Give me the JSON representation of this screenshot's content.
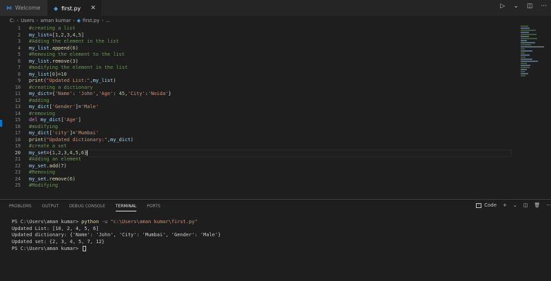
{
  "tabs": [
    {
      "label": "Welcome",
      "icon": "vscode-logo-icon"
    },
    {
      "label": "first.py",
      "icon": "python-file-icon"
    }
  ],
  "breadcrumb": [
    "C:",
    "Users",
    "aman kumar",
    "first.py",
    "..."
  ],
  "code_lines": [
    {
      "n": "1",
      "segs": [
        {
          "t": "#creating a list",
          "c": "comment"
        }
      ]
    },
    {
      "n": "2",
      "segs": [
        {
          "t": "my_list",
          "c": "var"
        },
        {
          "t": "=[",
          "c": "plain"
        },
        {
          "t": "1",
          "c": "num"
        },
        {
          "t": ",",
          "c": "plain"
        },
        {
          "t": "2",
          "c": "num"
        },
        {
          "t": ",",
          "c": "plain"
        },
        {
          "t": "3",
          "c": "num"
        },
        {
          "t": ",",
          "c": "plain"
        },
        {
          "t": "4",
          "c": "num"
        },
        {
          "t": ",",
          "c": "plain"
        },
        {
          "t": "5",
          "c": "num"
        },
        {
          "t": "]",
          "c": "plain"
        }
      ]
    },
    {
      "n": "3",
      "segs": [
        {
          "t": "#Adding the element in the list",
          "c": "comment"
        }
      ]
    },
    {
      "n": "4",
      "segs": [
        {
          "t": "my_list",
          "c": "var"
        },
        {
          "t": ".",
          "c": "plain"
        },
        {
          "t": "append",
          "c": "fn"
        },
        {
          "t": "(",
          "c": "plain"
        },
        {
          "t": "6",
          "c": "num"
        },
        {
          "t": ")",
          "c": "plain"
        }
      ]
    },
    {
      "n": "5",
      "segs": [
        {
          "t": "#Removing the element to the list",
          "c": "comment"
        }
      ]
    },
    {
      "n": "6",
      "segs": [
        {
          "t": "my_list",
          "c": "var"
        },
        {
          "t": ".",
          "c": "plain"
        },
        {
          "t": "remove",
          "c": "fn"
        },
        {
          "t": "(",
          "c": "plain"
        },
        {
          "t": "3",
          "c": "num"
        },
        {
          "t": ")",
          "c": "plain"
        }
      ]
    },
    {
      "n": "7",
      "segs": [
        {
          "t": "#modifying the element in the list",
          "c": "comment"
        }
      ]
    },
    {
      "n": "8",
      "segs": [
        {
          "t": "my_list",
          "c": "var"
        },
        {
          "t": "[",
          "c": "plain"
        },
        {
          "t": "0",
          "c": "num"
        },
        {
          "t": "]=",
          "c": "plain"
        },
        {
          "t": "10",
          "c": "num"
        }
      ]
    },
    {
      "n": "9",
      "segs": [
        {
          "t": "print",
          "c": "fn"
        },
        {
          "t": "(",
          "c": "plain"
        },
        {
          "t": "\"Updated List:\"",
          "c": "str"
        },
        {
          "t": ",",
          "c": "plain"
        },
        {
          "t": "my_list",
          "c": "var"
        },
        {
          "t": ")",
          "c": "plain"
        }
      ]
    },
    {
      "n": "10",
      "segs": [
        {
          "t": "#creating a dictionary",
          "c": "comment"
        }
      ]
    },
    {
      "n": "11",
      "segs": [
        {
          "t": "my_dict",
          "c": "var"
        },
        {
          "t": "={",
          "c": "plain"
        },
        {
          "t": "'Name'",
          "c": "str"
        },
        {
          "t": ": ",
          "c": "plain"
        },
        {
          "t": "'John'",
          "c": "str"
        },
        {
          "t": ",",
          "c": "plain"
        },
        {
          "t": "'Age'",
          "c": "str"
        },
        {
          "t": ": ",
          "c": "plain"
        },
        {
          "t": "45",
          "c": "num"
        },
        {
          "t": ",",
          "c": "plain"
        },
        {
          "t": "'City'",
          "c": "str"
        },
        {
          "t": ":",
          "c": "plain"
        },
        {
          "t": "'Noida'",
          "c": "str"
        },
        {
          "t": "}",
          "c": "plain"
        }
      ]
    },
    {
      "n": "12",
      "segs": [
        {
          "t": "#adding",
          "c": "comment"
        }
      ]
    },
    {
      "n": "13",
      "segs": [
        {
          "t": "my_dict",
          "c": "var"
        },
        {
          "t": "[",
          "c": "plain"
        },
        {
          "t": "'Gender'",
          "c": "str"
        },
        {
          "t": "]=",
          "c": "plain"
        },
        {
          "t": "'Male'",
          "c": "str"
        }
      ]
    },
    {
      "n": "14",
      "segs": [
        {
          "t": "#removing",
          "c": "comment"
        }
      ]
    },
    {
      "n": "15",
      "segs": [
        {
          "t": "del ",
          "c": "kw"
        },
        {
          "t": "my_dict",
          "c": "var"
        },
        {
          "t": "[",
          "c": "plain"
        },
        {
          "t": "'Age'",
          "c": "str"
        },
        {
          "t": "]",
          "c": "plain"
        }
      ]
    },
    {
      "n": "16",
      "segs": [
        {
          "t": "#modifying",
          "c": "comment"
        }
      ]
    },
    {
      "n": "17",
      "segs": [
        {
          "t": "my_dict",
          "c": "var"
        },
        {
          "t": "[",
          "c": "plain"
        },
        {
          "t": "'city'",
          "c": "str"
        },
        {
          "t": "]=",
          "c": "plain"
        },
        {
          "t": "'Mumbai'",
          "c": "str"
        }
      ]
    },
    {
      "n": "18",
      "segs": [
        {
          "t": "print",
          "c": "fn"
        },
        {
          "t": "(",
          "c": "plain"
        },
        {
          "t": "\"Updated dictionary:\"",
          "c": "str"
        },
        {
          "t": ",",
          "c": "plain"
        },
        {
          "t": "my_dict",
          "c": "var"
        },
        {
          "t": ")",
          "c": "plain"
        }
      ]
    },
    {
      "n": "19",
      "segs": [
        {
          "t": "#create a set",
          "c": "comment"
        }
      ]
    },
    {
      "n": "20",
      "segs": [
        {
          "t": "my_set",
          "c": "var"
        },
        {
          "t": "={",
          "c": "plain"
        },
        {
          "t": "1",
          "c": "num"
        },
        {
          "t": ",",
          "c": "plain"
        },
        {
          "t": "2",
          "c": "num"
        },
        {
          "t": ",",
          "c": "plain"
        },
        {
          "t": "3",
          "c": "num"
        },
        {
          "t": ",",
          "c": "plain"
        },
        {
          "t": "4",
          "c": "num"
        },
        {
          "t": ",",
          "c": "plain"
        },
        {
          "t": "5",
          "c": "num"
        },
        {
          "t": ",",
          "c": "plain"
        },
        {
          "t": "6",
          "c": "num"
        },
        {
          "t": "}",
          "c": "plain"
        }
      ]
    },
    {
      "n": "21",
      "segs": [
        {
          "t": "#Adding an element",
          "c": "comment"
        }
      ]
    },
    {
      "n": "22",
      "segs": [
        {
          "t": "my_set",
          "c": "var"
        },
        {
          "t": ".",
          "c": "plain"
        },
        {
          "t": "add",
          "c": "fn"
        },
        {
          "t": "(",
          "c": "plain"
        },
        {
          "t": "7",
          "c": "num"
        },
        {
          "t": ")",
          "c": "plain"
        }
      ]
    },
    {
      "n": "23",
      "segs": [
        {
          "t": "#Removing",
          "c": "comment"
        }
      ]
    },
    {
      "n": "24",
      "segs": [
        {
          "t": "my_set",
          "c": "var"
        },
        {
          "t": ".",
          "c": "plain"
        },
        {
          "t": "remove",
          "c": "fn"
        },
        {
          "t": "(",
          "c": "plain"
        },
        {
          "t": "6",
          "c": "num"
        },
        {
          "t": ")",
          "c": "plain"
        }
      ]
    },
    {
      "n": "25",
      "segs": [
        {
          "t": "#Modifying",
          "c": "comment"
        }
      ]
    }
  ],
  "active_line": "20",
  "panel": {
    "tabs": [
      "PROBLEMS",
      "OUTPUT",
      "DEBUG CONSOLE",
      "TERMINAL",
      "PORTS"
    ],
    "active_tab": "TERMINAL",
    "terminal_selector": "Code"
  },
  "terminal": {
    "prompt1": "PS C:\\Users\\aman kumar> ",
    "cmd": "python",
    "flag": " -u ",
    "path": "\"c:\\Users\\aman kumar\\first.py\"",
    "out1": "Updated List: [10, 2, 4, 5, 6]",
    "out2": "Updated dictionary: {'Name': 'John', 'City': 'Mumbai', 'Gender': 'Male'}",
    "out3": "Updated set: {2, 3, 4, 5, 7, 12}",
    "prompt2": "PS C:\\Users\\aman kumar> "
  },
  "colors": {
    "comment": "#6a9955",
    "var": "#9cdcfe",
    "fn": "#dcdcaa",
    "str": "#ce9178",
    "num": "#b5cea8",
    "kw": "#c586c0",
    "plain": "#d4d4d4",
    "accent": "#007acc"
  }
}
